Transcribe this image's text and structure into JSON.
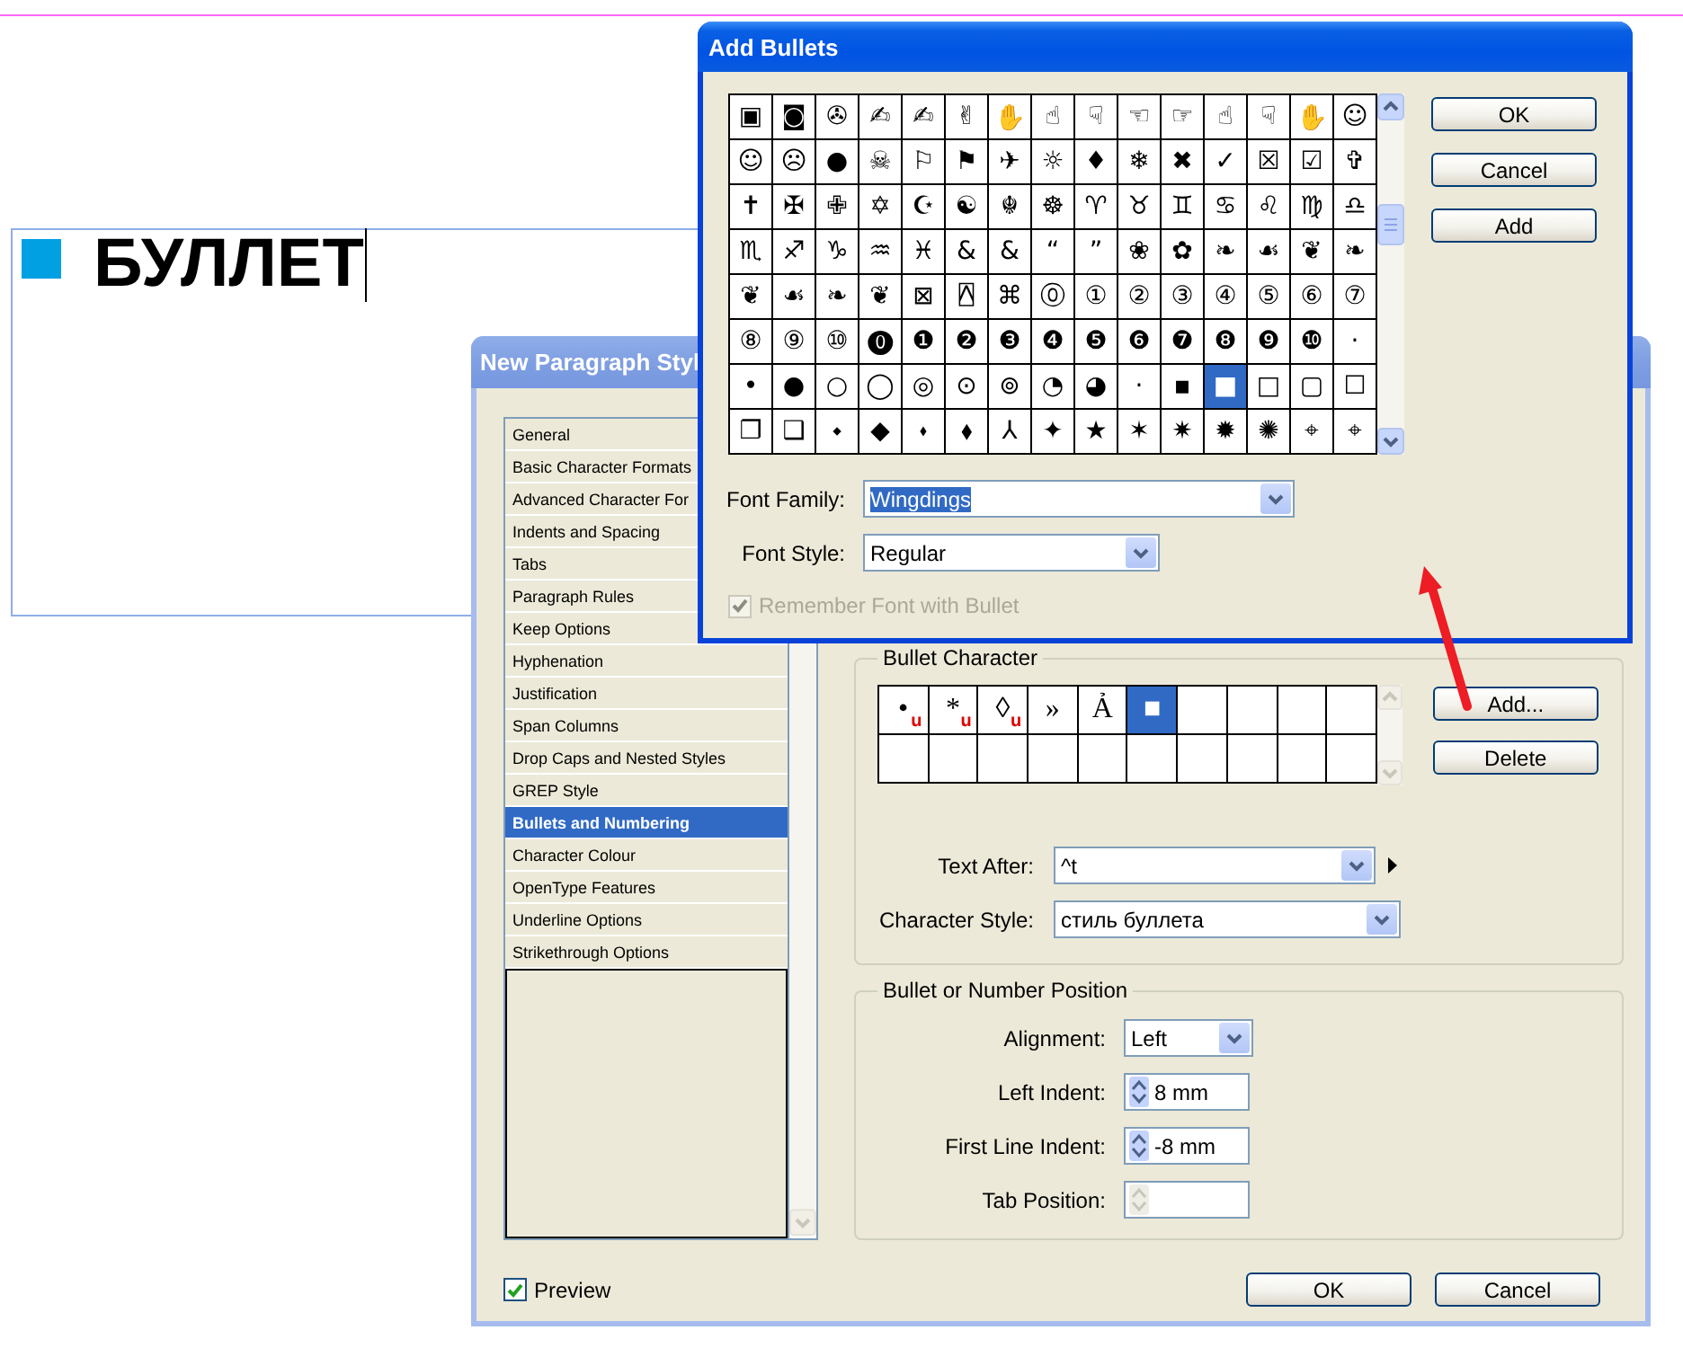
{
  "document": {
    "text": "БУЛЛЕТ"
  },
  "paragraph_style_dialog": {
    "title": "New Paragraph Styl",
    "categories": [
      {
        "label": "General",
        "selected": false
      },
      {
        "label": "Basic Character Formats",
        "selected": false
      },
      {
        "label": "Advanced Character For",
        "selected": false
      },
      {
        "label": "Indents and Spacing",
        "selected": false
      },
      {
        "label": "Tabs",
        "selected": false
      },
      {
        "label": "Paragraph Rules",
        "selected": false
      },
      {
        "label": "Keep Options",
        "selected": false
      },
      {
        "label": "Hyphenation",
        "selected": false
      },
      {
        "label": "Justification",
        "selected": false
      },
      {
        "label": "Span Columns",
        "selected": false
      },
      {
        "label": "Drop Caps and Nested Styles",
        "selected": false
      },
      {
        "label": "GREP Style",
        "selected": false
      },
      {
        "label": "Bullets and Numbering",
        "selected": true
      },
      {
        "label": "Character Colour",
        "selected": false
      },
      {
        "label": "OpenType Features",
        "selected": false
      },
      {
        "label": "Underline Options",
        "selected": false
      },
      {
        "label": "Strikethrough Options",
        "selected": false
      }
    ],
    "bullet_character": {
      "heading": "Bullet Character",
      "bullets": [
        {
          "glyph": "•",
          "flag": "u",
          "selected": false
        },
        {
          "glyph": "*",
          "flag": "u",
          "selected": false
        },
        {
          "glyph": "◊",
          "flag": "u",
          "selected": false
        },
        {
          "glyph": "»",
          "selected": false
        },
        {
          "glyph": "Ả",
          "selected": false
        },
        {
          "glyph": "■",
          "selected": true
        }
      ],
      "add_button": "Add...",
      "delete_button": "Delete",
      "text_after": {
        "label": "Text After:",
        "value": "^t"
      },
      "character_style": {
        "label": "Character Style:",
        "value": "стиль буллета"
      }
    },
    "position": {
      "heading": "Bullet or Number Position",
      "alignment": {
        "label": "Alignment:",
        "value": "Left"
      },
      "left_indent": {
        "label": "Left Indent:",
        "value": "8 mm"
      },
      "first_line_indent": {
        "label": "First Line Indent:",
        "value": "-8 mm"
      },
      "tab_position": {
        "label": "Tab Position:",
        "disabled": true
      }
    },
    "preview": {
      "label": "Preview",
      "checked": true
    },
    "buttons": [
      "OK",
      "Cancel"
    ]
  },
  "add_bullets_dialog": {
    "title": "Add Bullets",
    "glyph_rows": [
      [
        {
          "glyph": "▣",
          "selected": false
        },
        {
          "glyph": "◙",
          "selected": false
        },
        {
          "glyph": "✇",
          "selected": false
        },
        {
          "glyph": "✍",
          "selected": false
        },
        {
          "glyph": "✍",
          "selected": false
        },
        {
          "glyph": "✌",
          "selected": false
        },
        {
          "glyph": "✋",
          "selected": false
        },
        {
          "glyph": "☝",
          "selected": false
        },
        {
          "glyph": "☟",
          "selected": false
        },
        {
          "glyph": "☜",
          "selected": false
        },
        {
          "glyph": "☞",
          "selected": false
        },
        {
          "glyph": "☝",
          "selected": false
        },
        {
          "glyph": "☟",
          "selected": false
        },
        {
          "glyph": "✋",
          "selected": false
        },
        {
          "glyph": "☺",
          "selected": false
        }
      ],
      [
        {
          "glyph": "☺",
          "selected": false
        },
        {
          "glyph": "☹",
          "selected": false
        },
        {
          "glyph": "●",
          "selected": false
        },
        {
          "glyph": "☠",
          "selected": false
        },
        {
          "glyph": "⚐",
          "selected": false
        },
        {
          "glyph": "⚑",
          "selected": false
        },
        {
          "glyph": "✈",
          "selected": false
        },
        {
          "glyph": "☼",
          "selected": false
        },
        {
          "glyph": "♦",
          "selected": false
        },
        {
          "glyph": "❄",
          "selected": false
        },
        {
          "glyph": "✖",
          "selected": false
        },
        {
          "glyph": "✓",
          "selected": false
        },
        {
          "glyph": "☒",
          "selected": false
        },
        {
          "glyph": "☑",
          "selected": false
        },
        {
          "glyph": "✞",
          "selected": false
        }
      ],
      [
        {
          "glyph": "✝",
          "selected": false
        },
        {
          "glyph": "✠",
          "selected": false
        },
        {
          "glyph": "✙",
          "selected": false
        },
        {
          "glyph": "✡",
          "selected": false
        },
        {
          "glyph": "☪",
          "selected": false
        },
        {
          "glyph": "☯",
          "selected": false
        },
        {
          "glyph": "☬",
          "selected": false
        },
        {
          "glyph": "☸",
          "selected": false
        },
        {
          "glyph": "♈",
          "selected": false
        },
        {
          "glyph": "♉",
          "selected": false
        },
        {
          "glyph": "♊",
          "selected": false
        },
        {
          "glyph": "♋",
          "selected": false
        },
        {
          "glyph": "♌",
          "selected": false
        },
        {
          "glyph": "♍",
          "selected": false
        },
        {
          "glyph": "♎",
          "selected": false
        }
      ],
      [
        {
          "glyph": "♏",
          "selected": false
        },
        {
          "glyph": "♐",
          "selected": false
        },
        {
          "glyph": "♑",
          "selected": false
        },
        {
          "glyph": "♒",
          "selected": false
        },
        {
          "glyph": "♓",
          "selected": false
        },
        {
          "glyph": "&",
          "selected": false
        },
        {
          "glyph": "&",
          "selected": false
        },
        {
          "glyph": "“",
          "selected": false
        },
        {
          "glyph": "”",
          "selected": false
        },
        {
          "glyph": "❀",
          "selected": false
        },
        {
          "glyph": "✿",
          "selected": false
        },
        {
          "glyph": "❧",
          "selected": false
        },
        {
          "glyph": "☙",
          "selected": false
        },
        {
          "glyph": "❦",
          "selected": false
        },
        {
          "glyph": "❧",
          "selected": false
        }
      ],
      [
        {
          "glyph": "❦",
          "selected": false
        },
        {
          "glyph": "☙",
          "selected": false
        },
        {
          "glyph": "❧",
          "selected": false
        },
        {
          "glyph": "❦",
          "selected": false
        },
        {
          "glyph": "⊠",
          "selected": false
        },
        {
          "glyph": "⍓",
          "selected": false
        },
        {
          "glyph": "⌘",
          "selected": false
        },
        {
          "glyph": "⓪",
          "selected": false
        },
        {
          "glyph": "①",
          "selected": false
        },
        {
          "glyph": "②",
          "selected": false
        },
        {
          "glyph": "③",
          "selected": false
        },
        {
          "glyph": "④",
          "selected": false
        },
        {
          "glyph": "⑤",
          "selected": false
        },
        {
          "glyph": "⑥",
          "selected": false
        },
        {
          "glyph": "⑦",
          "selected": false
        }
      ],
      [
        {
          "glyph": "⑧",
          "selected": false
        },
        {
          "glyph": "⑨",
          "selected": false
        },
        {
          "glyph": "⑩",
          "selected": false
        },
        {
          "glyph": "⓿",
          "selected": false
        },
        {
          "glyph": "❶",
          "selected": false
        },
        {
          "glyph": "❷",
          "selected": false
        },
        {
          "glyph": "❸",
          "selected": false
        },
        {
          "glyph": "❹",
          "selected": false
        },
        {
          "glyph": "❺",
          "selected": false
        },
        {
          "glyph": "❻",
          "selected": false
        },
        {
          "glyph": "❼",
          "selected": false
        },
        {
          "glyph": "❽",
          "selected": false
        },
        {
          "glyph": "❾",
          "selected": false
        },
        {
          "glyph": "❿",
          "selected": false
        },
        {
          "glyph": "·",
          "selected": false
        }
      ],
      [
        {
          "glyph": "•",
          "selected": false
        },
        {
          "glyph": "●",
          "selected": false
        },
        {
          "glyph": "○",
          "selected": false
        },
        {
          "glyph": "◯",
          "selected": false
        },
        {
          "glyph": "◎",
          "selected": false
        },
        {
          "glyph": "⊙",
          "selected": false
        },
        {
          "glyph": "⊚",
          "selected": false
        },
        {
          "glyph": "◔",
          "selected": false
        },
        {
          "glyph": "◕",
          "selected": false
        },
        {
          "glyph": "·",
          "selected": false
        },
        {
          "glyph": "▪",
          "selected": false
        },
        {
          "glyph": "■",
          "selected": true
        },
        {
          "glyph": "□",
          "selected": false
        },
        {
          "glyph": "▢",
          "selected": false
        },
        {
          "glyph": "☐",
          "selected": false
        }
      ],
      [
        {
          "glyph": "❐",
          "selected": false
        },
        {
          "glyph": "❑",
          "selected": false
        },
        {
          "glyph": "⬩",
          "selected": false
        },
        {
          "glyph": "◆",
          "selected": false
        },
        {
          "glyph": "⬪",
          "selected": false
        },
        {
          "glyph": "⬧",
          "selected": false
        },
        {
          "glyph": "⅄",
          "selected": false
        },
        {
          "glyph": "✦",
          "selected": false
        },
        {
          "glyph": "★",
          "selected": false
        },
        {
          "glyph": "✶",
          "selected": false
        },
        {
          "glyph": "✷",
          "selected": false
        },
        {
          "glyph": "✹",
          "selected": false
        },
        {
          "glyph": "✺",
          "selected": false
        },
        {
          "glyph": "⌖",
          "selected": false
        },
        {
          "glyph": "⌖",
          "selected": false
        }
      ]
    ],
    "buttons": [
      "OK",
      "Cancel",
      "Add"
    ],
    "font_family": {
      "label": "Font Family:",
      "value": "Wingdings",
      "highlighted": true
    },
    "font_style": {
      "label": "Font Style:",
      "value": "Regular"
    },
    "remember_font": {
      "label": "Remember Font with Bullet",
      "checked": true,
      "disabled": true
    }
  }
}
